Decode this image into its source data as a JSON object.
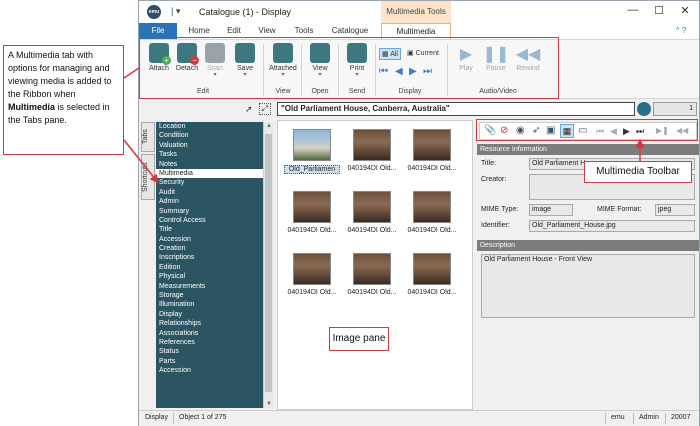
{
  "window": {
    "app_icon": "emu",
    "qat_glyph": "|  ▾",
    "title": "Catalogue (1) - Display",
    "minimize": "—",
    "maximize": "☐",
    "close": "✕",
    "help": "^ ?"
  },
  "ribbon_tabs": {
    "contextual_header": "Multimedia Tools",
    "file": "File",
    "home": "Home",
    "edit": "Edit",
    "view": "View",
    "tools": "Tools",
    "catalogue": "Catalogue",
    "multimedia": "Multimedia"
  },
  "ribbon": {
    "attach": "Attach",
    "detach": "Detach",
    "scan": "Scan",
    "save": "Save",
    "attached": "Attached",
    "view": "View",
    "print": "Print",
    "all": "All",
    "current": "Current",
    "play": "Play",
    "pause": "Pause",
    "rewind": "Rewind",
    "groups": {
      "edit": "Edit",
      "view": "View",
      "open": "Open",
      "send": "Send",
      "display": "Display",
      "audio_video": "Audio/Video"
    }
  },
  "record_bar": {
    "record_title": "\"Old Parliament House, Canberra, Australia\"",
    "record_count": "1"
  },
  "left_pane": {
    "side_tabs": [
      "Tabs",
      "Shortcuts"
    ],
    "items": [
      "Location",
      "Condition",
      "Valuation",
      "Tasks",
      "Notes",
      "Multimedia",
      "Security",
      "Audit",
      "Admin",
      "Summary",
      "Control Access",
      "Title",
      "Accession",
      "Creation",
      "Inscriptions",
      "Edition",
      "Physical",
      "Measurements",
      "Storage",
      "Illumination",
      "Display",
      "Relationships",
      "Associations",
      "References",
      "Status",
      "Parts",
      "Accession"
    ],
    "selected_index": 5
  },
  "image_pane": {
    "thumbnails": [
      "Old_Parliamen",
      "040194DI Old...",
      "040194DI Old...",
      "040194DI Old...",
      "040194DI Old...",
      "040194DI Old...",
      "040194DI Old...",
      "040194DI Old...",
      "040194DI Old..."
    ]
  },
  "resource_info": {
    "header": "Resource Information",
    "title_label": "Title:",
    "title_value": "Old Parliament Ho",
    "creator_label": "Creator:",
    "creator_value": "",
    "mime_type_label": "MIME Type:",
    "mime_type_value": "image",
    "mime_format_label": "MIME Format:",
    "mime_format_value": "jpeg",
    "identifier_label": "Identifier:",
    "identifier_value": "Old_Parliament_House.jpg"
  },
  "description": {
    "header": "Description",
    "text": "Old Parliament House - Front View"
  },
  "status_bar": {
    "mode": "Display",
    "position": "Object 1 of 275",
    "module": "emu",
    "user": "Admin",
    "version": "20007"
  },
  "callouts": {
    "multimedia_tab_intro": "A Multimedia tab with options for managing and viewing media is added to the Ribbon when",
    "multimedia_tab_bold": "Multimedia",
    "multimedia_tab_outro": "is selected in the Tabs pane.",
    "toolbar": "Multimedia Toolbar",
    "image_pane": "Image pane"
  },
  "colors": {
    "accent": "#2a73b8",
    "tab_list_bg": "#2c5563",
    "callout_red": "#d9363e",
    "contextual_tab": "#fde4c8"
  }
}
